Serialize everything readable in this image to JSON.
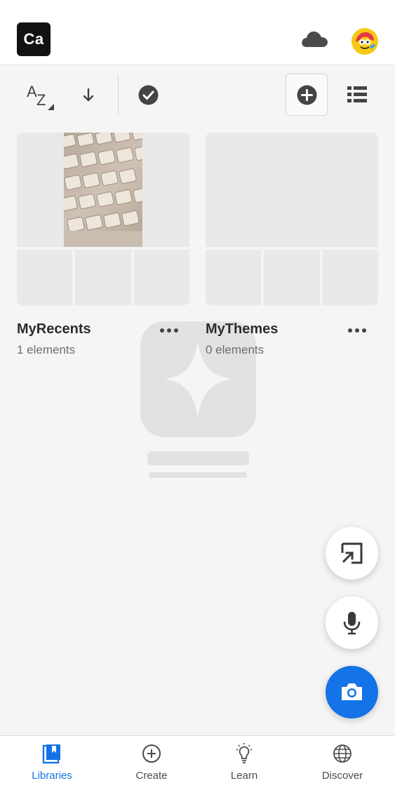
{
  "app": {
    "logo_text": "Ca"
  },
  "header": {
    "cloud_icon": "cloud-icon",
    "avatar": "avatar"
  },
  "toolbar": {
    "sort_a": "A",
    "sort_z": "Z",
    "icons": [
      "sort-az-icon",
      "arrow-down-icon",
      "check-circle-icon",
      "add-circle-icon",
      "list-view-icon"
    ]
  },
  "libraries": [
    {
      "title": "MyRecents",
      "count": "1 elements"
    },
    {
      "title": "MyThemes",
      "count": "0 elements"
    }
  ],
  "fabs": [
    "screen-capture-icon",
    "microphone-icon",
    "camera-icon"
  ],
  "bottom_nav": {
    "active": "Libraries",
    "items": [
      {
        "label": "Libraries",
        "icon": "libraries-icon"
      },
      {
        "label": "Create",
        "icon": "plus-circle-icon"
      },
      {
        "label": "Learn",
        "icon": "lightbulb-icon"
      },
      {
        "label": "Discover",
        "icon": "globe-icon"
      }
    ]
  },
  "colors": {
    "accent": "#1473e6",
    "background": "#f5f5f5",
    "logo_bg": "#121212",
    "avatar_bg": "#f6c915"
  }
}
